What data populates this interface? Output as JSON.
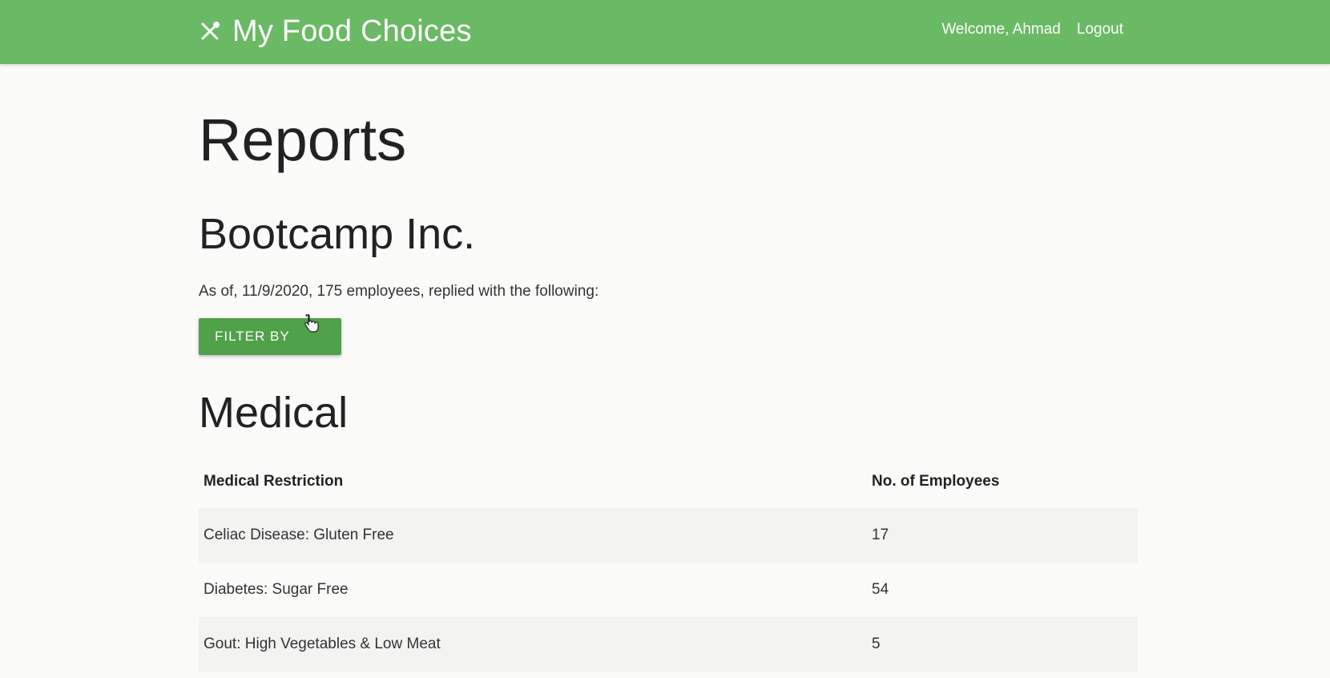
{
  "navbar": {
    "brand_icon": "fork-knife-icon",
    "brand_title": "My Food Choices",
    "welcome_text": "Welcome, Ahmad",
    "logout_label": "Logout",
    "background_color": "#6ab964"
  },
  "main": {
    "page_title": "Reports",
    "company_title": "Bootcamp Inc.",
    "summary_text": "As of, 11/9/2020, 175 employees, replied with the following:",
    "filter_button_label": "FILTER BY",
    "filter_button_color": "#4fa14a",
    "section_title": "Medical"
  },
  "table": {
    "headers": [
      "Medical Restriction",
      "No. of Employees"
    ],
    "rows": [
      {
        "restriction": "Celiac Disease: Gluten Free",
        "count": "17"
      },
      {
        "restriction": "Diabetes: Sugar Free",
        "count": "54"
      },
      {
        "restriction": "Gout: High Vegetables & Low Meat",
        "count": "5"
      }
    ]
  }
}
